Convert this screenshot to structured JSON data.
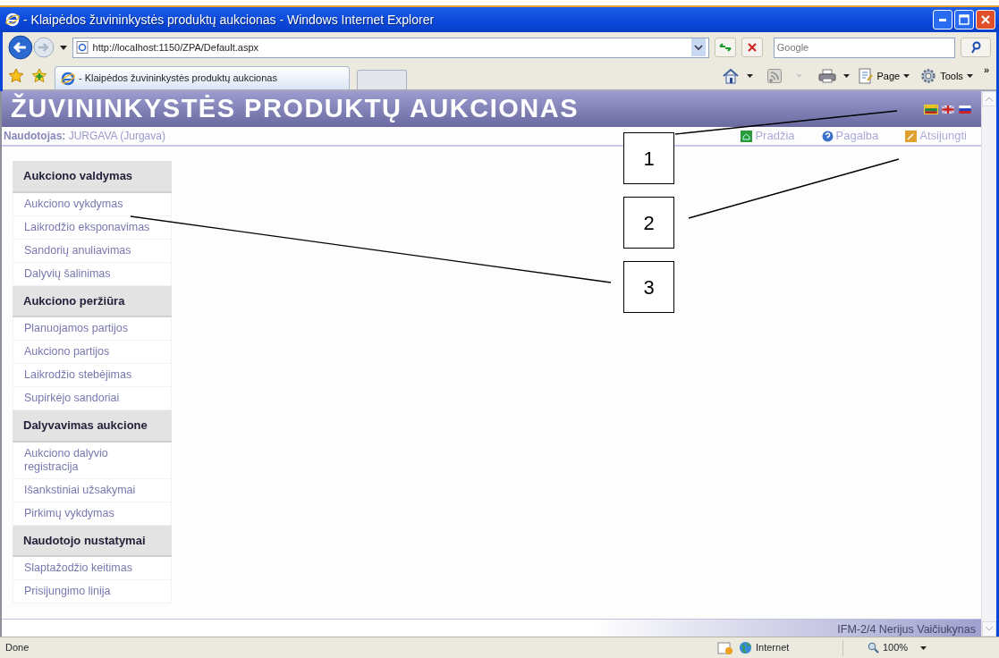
{
  "window": {
    "title": "- Klaipėdos žuvininkystės produktų aukcionas - Windows Internet Explorer"
  },
  "address_bar": {
    "url": "http://localhost:1150/ZPA/Default.aspx"
  },
  "search": {
    "placeholder": "Google"
  },
  "tab": {
    "title": "- Klaipėdos žuvininkystės produktų aukcionas"
  },
  "command_bar": {
    "page": "Page",
    "tools": "Tools",
    "more": "»"
  },
  "page": {
    "title": "ŽUVININKYSTĖS PRODUKTŲ AUKCIONAS",
    "languages": [
      {
        "kind": "lt",
        "selected": true
      },
      {
        "kind": "gb",
        "selected": false
      },
      {
        "kind": "ru",
        "selected": false
      }
    ],
    "user_label": "Naudotojas:",
    "user_value": "JURGAVA (Jurgava)",
    "links": [
      {
        "kind": "home",
        "label": "Pradžia"
      },
      {
        "kind": "help",
        "label": "Pagalba"
      },
      {
        "kind": "logout",
        "label": "Atsijungti"
      }
    ],
    "menu": [
      {
        "title": "Aukciono valdymas",
        "items": [
          "Aukciono vykdymas",
          "Laikrodžio eksponavimas",
          "Sandorių anuliavimas",
          "Dalyvių šalinimas"
        ]
      },
      {
        "title": "Aukciono peržiūra",
        "items": [
          "Planuojamos partijos",
          "Aukciono partijos",
          "Laikrodžio stebėjimas",
          "Supirkėjo sandoriai"
        ]
      },
      {
        "title": "Dalyvavimas aukcione",
        "items": [
          "Aukciono dalyvio registracija",
          "Išankstiniai užsakymai",
          "Pirkimų vykdymas"
        ]
      },
      {
        "title": "Naudotojo nustatymai",
        "items": [
          "Slaptažodžio keitimas",
          "Prisijungimo linija"
        ]
      }
    ],
    "footer": "IFM-2/4 Nerijus Vaičiukynas"
  },
  "callouts": [
    "1",
    "2",
    "3"
  ],
  "status_bar": {
    "text": "Done",
    "zone": "Internet",
    "zoom": "100%"
  }
}
